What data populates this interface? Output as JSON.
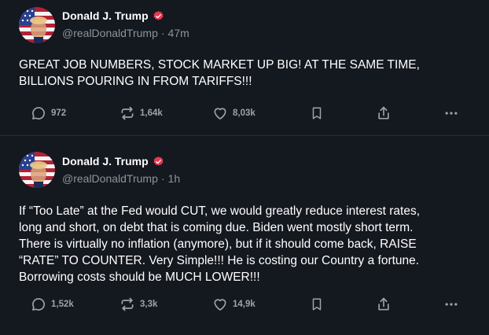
{
  "posts": [
    {
      "author": {
        "name": "Donald J. Trump",
        "handle": "@realDonaldTrump",
        "time": "47m"
      },
      "text": "GREAT JOB NUMBERS, STOCK MARKET UP BIG! AT THE SAME TIME,\nBILLIONS POURING IN FROM TARIFFS!!!",
      "stats": {
        "replies": "972",
        "reposts": "1,64k",
        "likes": "8,03k"
      }
    },
    {
      "author": {
        "name": "Donald J. Trump",
        "handle": "@realDonaldTrump",
        "time": "1h"
      },
      "text": "If “Too Late” at the Fed would CUT, we would greatly reduce interest rates,\nlong and short, on debt that is coming due. Biden went mostly short term.\nThere is virtually no inflation (anymore), but if it should come back, RAISE\n“RATE” TO COUNTER. Very Simple!!! He is costing our Country a fortune.\nBorrowing costs should be MUCH LOWER!!!",
      "stats": {
        "replies": "1,52k",
        "reposts": "3,3k",
        "likes": "14,9k"
      }
    }
  ],
  "icons": {
    "reply": "speech-bubble-icon",
    "repost": "repost-arrows-icon",
    "like": "heart-icon",
    "bookmark": "bookmark-icon",
    "share": "share-icon",
    "more": "more-dots-icon",
    "verified": "verified-badge-icon"
  },
  "colors": {
    "background": "#14181f",
    "text": "#ffffff",
    "muted": "#8b949e",
    "verified": "#e8384f",
    "divider": "#2b3038"
  }
}
